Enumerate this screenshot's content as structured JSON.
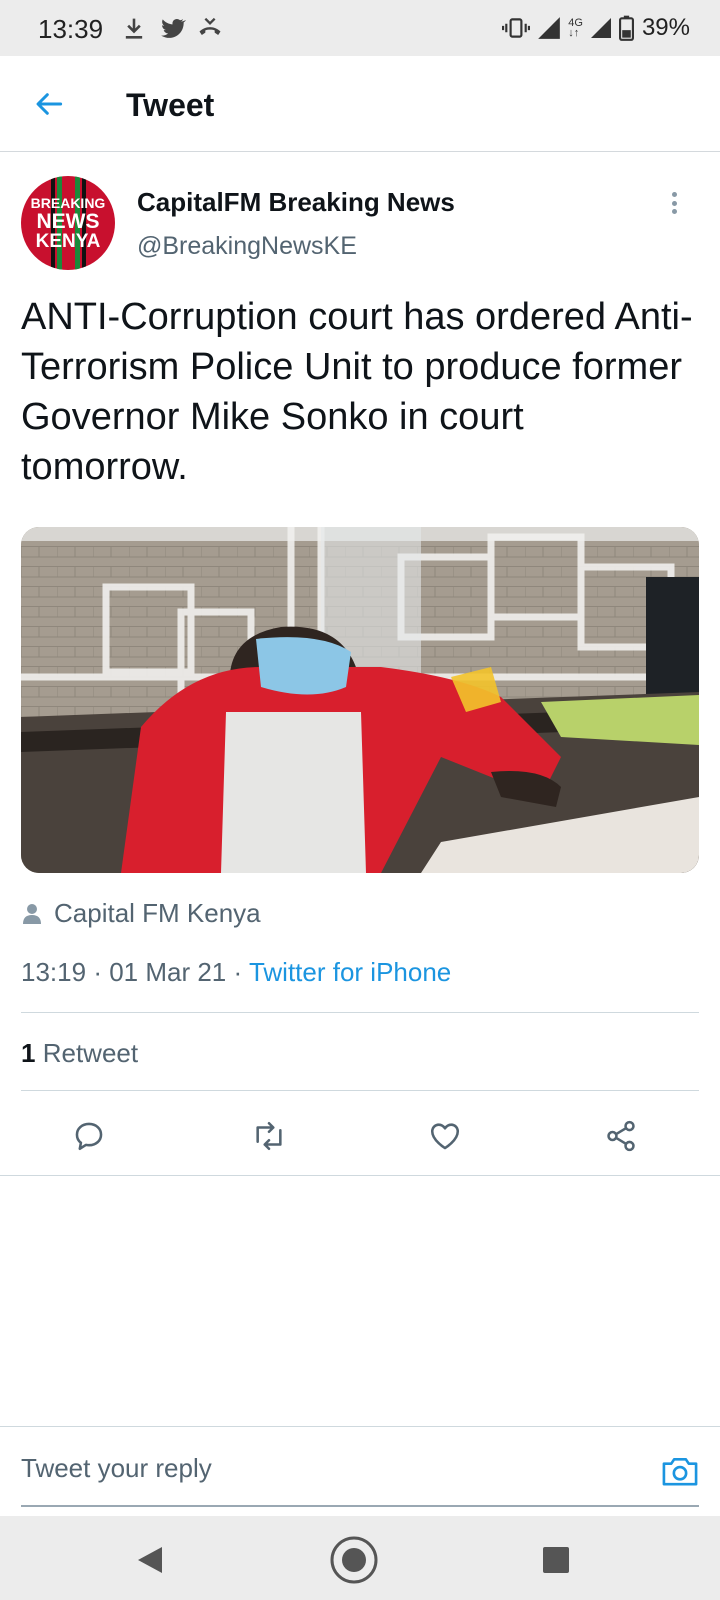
{
  "status_bar": {
    "time": "13:39",
    "battery": "39%",
    "network": "4G",
    "icons": [
      "download-icon",
      "twitter-icon",
      "missed-call-icon",
      "vibrate-icon",
      "signal-icon",
      "battery-icon"
    ]
  },
  "header": {
    "title": "Tweet"
  },
  "tweet": {
    "author_name": "CapitalFM Breaking News",
    "author_handle": "@BreakingNewsKE",
    "avatar_text": [
      "BREAKING",
      "NEWS",
      "KENYA"
    ],
    "text": "ANTI-Corruption court has ordered Anti-Terrorism Police Unit to produce former Governor Mike Sonko in court tomorrow.",
    "photo_credit": "Capital FM Kenya",
    "time": "13:19",
    "date": "01 Mar 21",
    "source": "Twitter for iPhone",
    "retweet_count": "1",
    "retweet_label": "Retweet"
  },
  "reply": {
    "placeholder": "Tweet your reply"
  },
  "colors": {
    "accent": "#1b95e0",
    "secondary_text": "#536471",
    "brand_red": "#c8102e"
  }
}
